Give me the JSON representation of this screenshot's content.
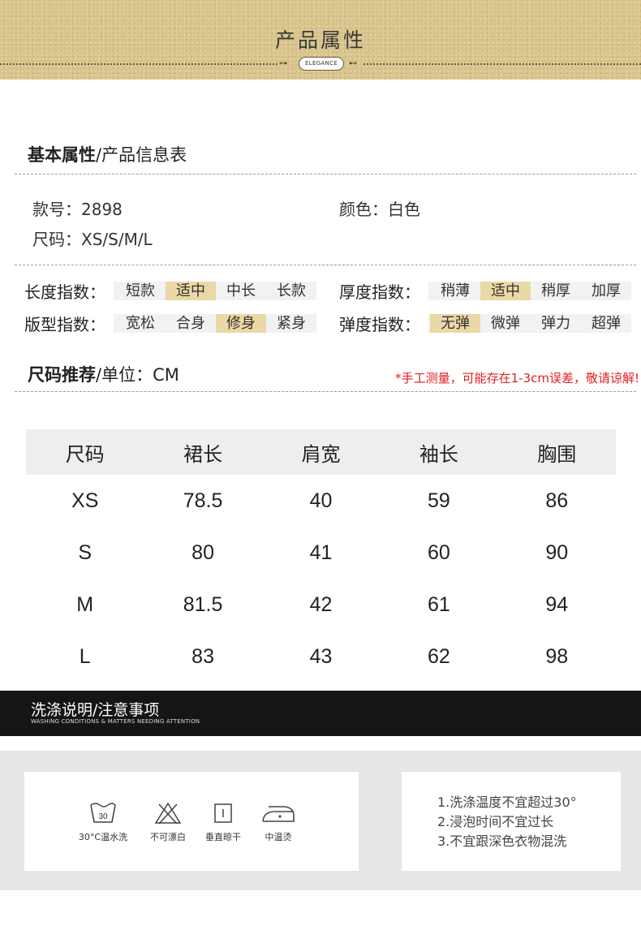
{
  "banner": {
    "title": "产品属性",
    "badge": "ELEGANCE"
  },
  "basic": {
    "heading_bold": "基本属性",
    "heading_light": "/产品信息表",
    "style_no": "款号：2898",
    "color": "颜色：白色",
    "sizes": "尺码：XS/S/M/L"
  },
  "indices": [
    {
      "label": "长度指数：",
      "options": [
        "短款",
        "适中",
        "中长",
        "长款"
      ],
      "selected": "适中"
    },
    {
      "label": "厚度指数：",
      "options": [
        "稍薄",
        "适中",
        "稍厚",
        "加厚"
      ],
      "selected": "适中"
    },
    {
      "label": "版型指数：",
      "options": [
        "宽松",
        "合身",
        "修身",
        "紧身"
      ],
      "selected": "修身"
    },
    {
      "label": "弹度指数：",
      "options": [
        "无弹",
        "微弹",
        "弹力",
        "超弹"
      ],
      "selected": "无弹"
    }
  ],
  "size_rec": {
    "heading_bold": "尺码推荐",
    "heading_light": "/单位：CM",
    "note": "*手工测量，可能存在1-3cm误差，敬请谅解!"
  },
  "size_table": {
    "headers": [
      "尺码",
      "裙长",
      "肩宽",
      "袖长",
      "胸围"
    ],
    "rows": [
      [
        "XS",
        "78.5",
        "40",
        "59",
        "86"
      ],
      [
        "S",
        "80",
        "41",
        "60",
        "90"
      ],
      [
        "M",
        "81.5",
        "42",
        "61",
        "94"
      ],
      [
        "L",
        "83",
        "43",
        "62",
        "98"
      ]
    ]
  },
  "washing": {
    "title": "洗涤说明/注意事项",
    "subtitle": "WASHING CONDITIONS & MATTERS NEEDING ATTENTION",
    "care": [
      {
        "icon": "wash-30-icon",
        "label": "30°C温水洗",
        "temp": "30"
      },
      {
        "icon": "no-bleach-icon",
        "label": "不可漂白"
      },
      {
        "icon": "hang-dry-icon",
        "label": "垂直晾干"
      },
      {
        "icon": "iron-medium-icon",
        "label": "中温烫"
      }
    ],
    "tips": [
      "1.洗涤温度不宜超过30°",
      "2.浸泡时间不宜过长",
      "3.不宜跟深色衣物混洗"
    ]
  }
}
